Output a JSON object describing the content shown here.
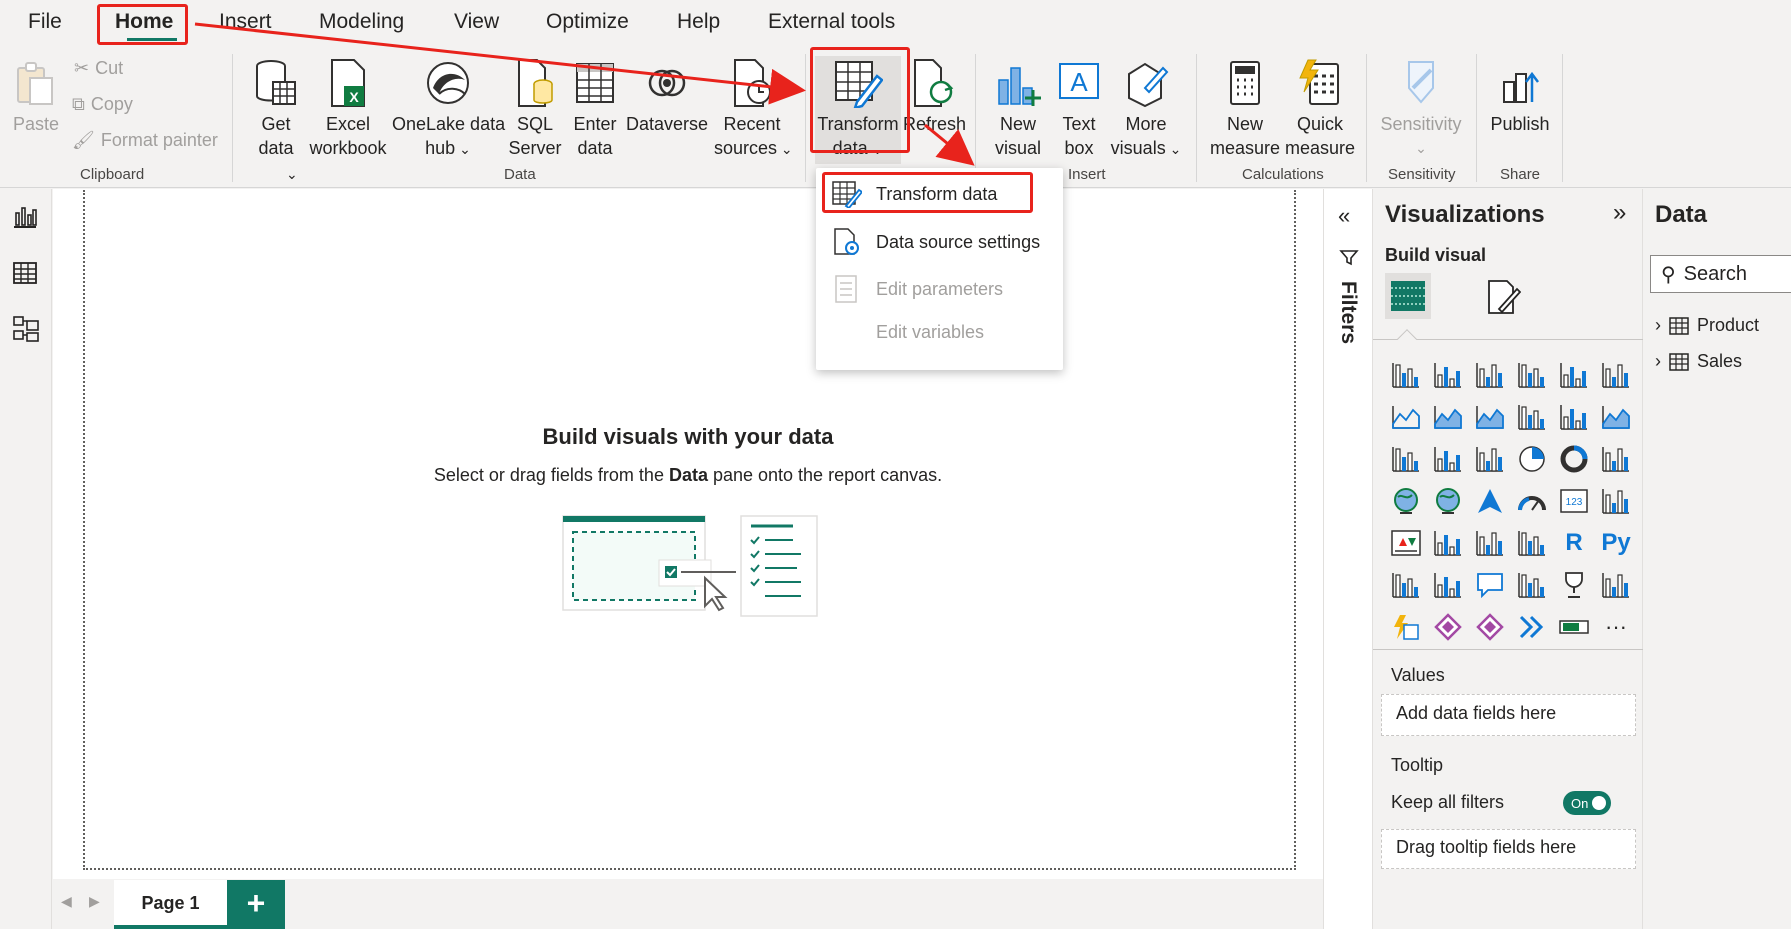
{
  "menu": {
    "items": [
      "File",
      "Home",
      "Insert",
      "Modeling",
      "View",
      "Optimize",
      "Help",
      "External tools"
    ],
    "active": "Home"
  },
  "ribbon": {
    "clipboard": {
      "paste": "Paste",
      "cut": "Cut",
      "copy": "Copy",
      "format_painter": "Format painter",
      "group": "Clipboard"
    },
    "data": {
      "get_data": "Get data",
      "excel_line1": "Excel",
      "excel_line2": "workbook",
      "onelake_line1": "OneLake data",
      "onelake_line2": "hub",
      "sql_line1": "SQL",
      "sql_line2": "Server",
      "enter_line1": "Enter",
      "enter_line2": "data",
      "dataverse": "Dataverse",
      "recent_line1": "Recent",
      "recent_line2": "sources",
      "group": "Data"
    },
    "queries": {
      "transform_line1": "Transform",
      "transform_line2": "data",
      "refresh": "Refresh"
    },
    "insert": {
      "new_visual_line1": "New",
      "new_visual_line2": "visual",
      "text_box_line1": "Text",
      "text_box_line2": "box",
      "more_visuals_line1": "More",
      "more_visuals_line2": "visuals",
      "group": "Insert"
    },
    "calculations": {
      "new_measure_line1": "New",
      "new_measure_line2": "measure",
      "quick_measure_line1": "Quick",
      "quick_measure_line2": "measure",
      "group": "Calculations"
    },
    "sensitivity": {
      "label": "Sensitivity",
      "group": "Sensitivity"
    },
    "share": {
      "publish": "Publish",
      "group": "Share"
    }
  },
  "dropdown": {
    "items": [
      {
        "label": "Transform data",
        "enabled": true
      },
      {
        "label": "Data source settings",
        "enabled": true
      },
      {
        "label": "Edit parameters",
        "enabled": false
      },
      {
        "label": "Edit variables",
        "enabled": false
      }
    ]
  },
  "canvas": {
    "empty_title": "Build visuals with your data",
    "empty_sub_before": "Select or drag fields from the ",
    "empty_sub_bold": "Data",
    "empty_sub_after": " pane onto the report canvas."
  },
  "pages": {
    "tabs": [
      "Page 1"
    ],
    "add": "+"
  },
  "filters": {
    "label": "Filters"
  },
  "visualizations": {
    "title": "Visualizations",
    "build_visual": "Build visual",
    "values_label": "Values",
    "values_placeholder": "Add data fields here",
    "tooltip_label": "Tooltip",
    "keep_filters": "Keep all filters",
    "toggle": "On",
    "tooltip_placeholder": "Drag tooltip fields here",
    "icons": [
      "stacked-bar-chart-icon",
      "stacked-column-chart-icon",
      "clustered-bar-chart-icon",
      "clustered-column-chart-icon",
      "100-stacked-bar-chart-icon",
      "100-stacked-column-chart-icon",
      "line-chart-icon",
      "area-chart-icon",
      "stacked-area-chart-icon",
      "line-and-column-chart-icon",
      "line-and-clustered-column-chart-icon",
      "ribbon-chart-icon",
      "waterfall-chart-icon",
      "funnel-icon",
      "scatter-chart-icon",
      "pie-chart-icon",
      "donut-chart-icon",
      "treemap-icon",
      "map-icon",
      "filled-map-icon",
      "azure-map-icon",
      "gauge-icon",
      "card-icon",
      "multi-row-card-icon",
      "kpi-icon",
      "slicer-icon",
      "table-icon",
      "matrix-icon",
      "r-visual-icon",
      "python-visual-icon",
      "key-influencers-icon",
      "decomposition-tree-icon",
      "qna-icon",
      "smart-narrative-icon",
      "metrics-icon",
      "paginated-report-icon",
      "power-automate-icon",
      "power-apps-icon",
      "diamond-visual-icon",
      "sparkle-chevron-icon",
      "slider-visual-icon",
      "more-visuals-icon"
    ],
    "ellipsis": "···",
    "r_letter": "R",
    "py_letters": "Py",
    "card_number": "123"
  },
  "data_pane": {
    "title": "Data",
    "search_placeholder": "Search",
    "tables": [
      "Product",
      "Sales"
    ]
  },
  "colors": {
    "accent": "#117865",
    "highlight_red": "#e8231c",
    "icon_blue": "#0f78d4"
  }
}
